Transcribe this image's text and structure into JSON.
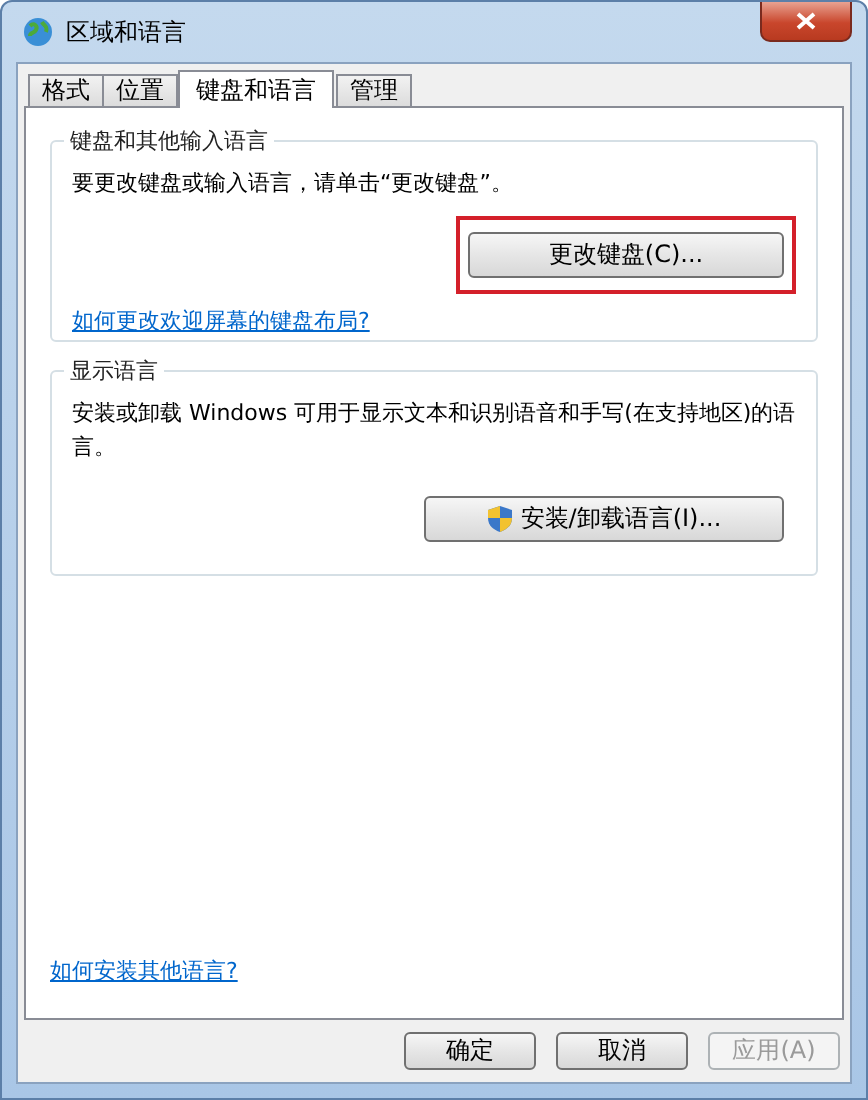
{
  "window": {
    "title": "区域和语言"
  },
  "tabs": [
    {
      "label": "格式",
      "selected": false
    },
    {
      "label": "位置",
      "selected": false
    },
    {
      "label": "键盘和语言",
      "selected": true
    },
    {
      "label": "管理",
      "selected": false
    }
  ],
  "groups": [
    {
      "title": "键盘和其他输入语言",
      "text": "要更改键盘或输入语言，请单击“更改键盘”。",
      "button": {
        "label": "更改键盘(C)...",
        "shield": false,
        "highlighted": true
      },
      "link": "如何更改欢迎屏幕的键盘布局?"
    },
    {
      "title": "显示语言",
      "text": "安装或卸载 Windows 可用于显示文本和识别语音和手写(在支持地区)的语言。",
      "button": {
        "label": "安装/卸载语言(I)...",
        "shield": true,
        "highlighted": false
      }
    }
  ],
  "bottom_link": "如何安装其他语言?",
  "buttons": [
    {
      "label": "确定",
      "disabled": false
    },
    {
      "label": "取消",
      "disabled": false
    },
    {
      "label": "应用(A)",
      "disabled": true
    }
  ]
}
